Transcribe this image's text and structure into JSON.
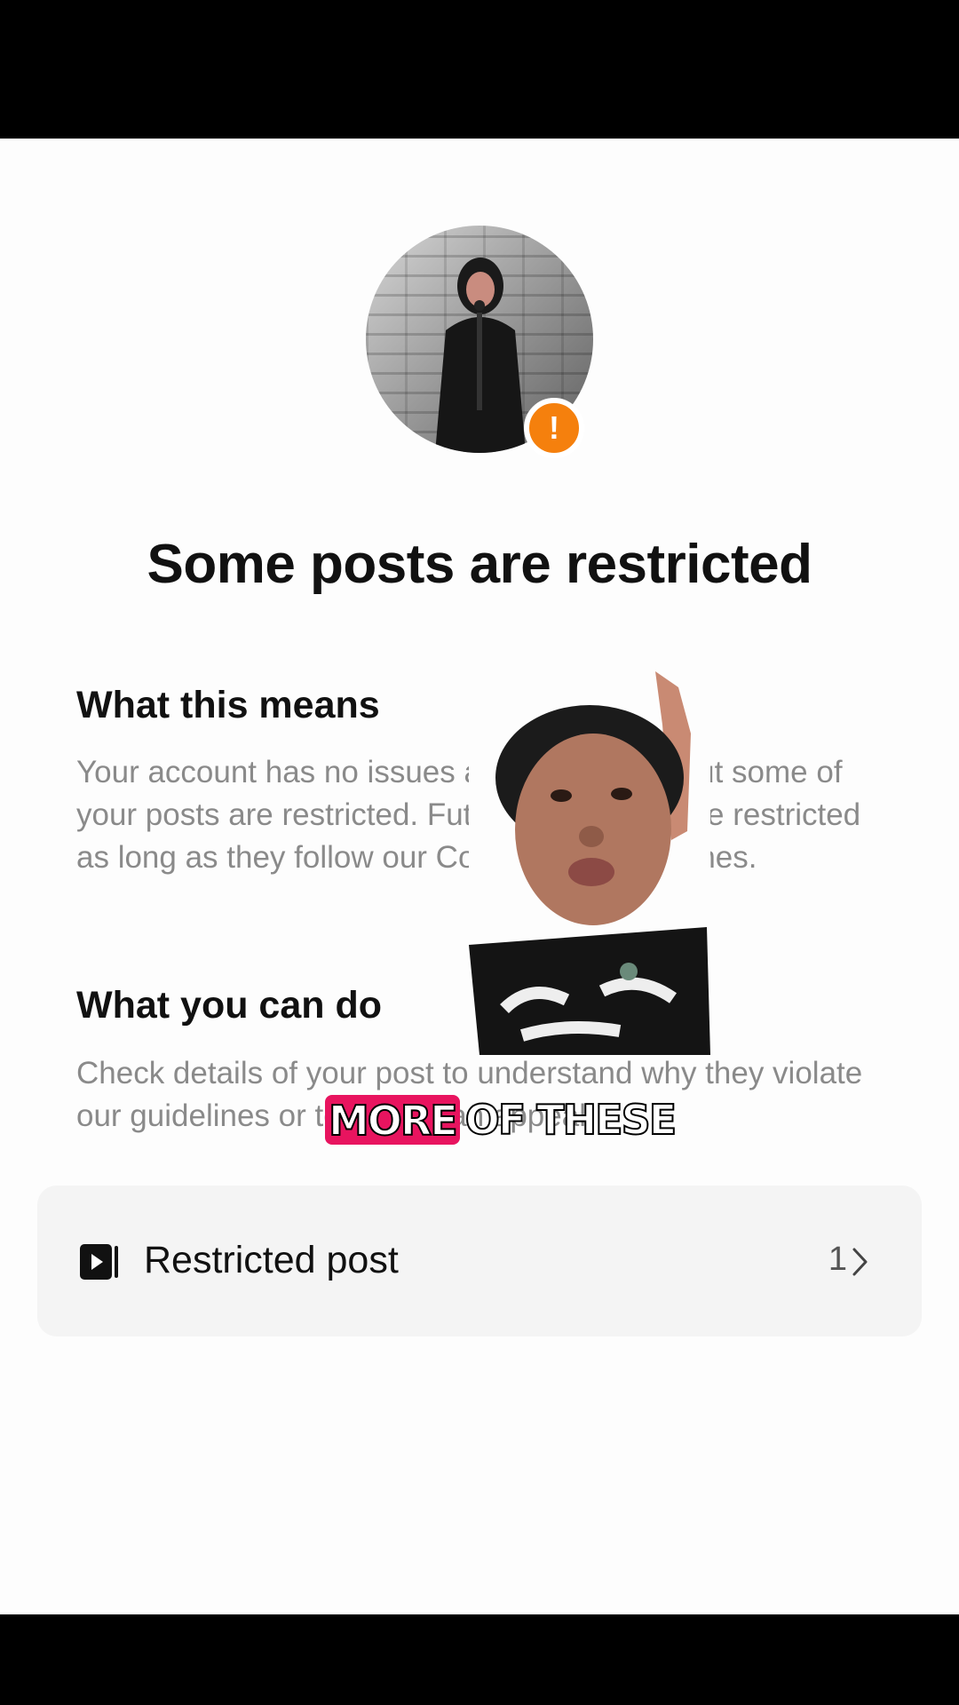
{
  "restriction_page": {
    "title": "Some posts are restricted",
    "alert_icon_glyph": "!",
    "alert_color": "#f5800d",
    "sections": [
      {
        "heading": "What this means",
        "body": "Your account has no issues at the moment, but some of your posts are restricted. Future posts won’t be restricted as long as they follow our Community Guidelines."
      },
      {
        "heading": "What you can do",
        "body": "Check details of your post to understand why they violate our guidelines or to submit an appeal."
      }
    ],
    "restricted_row": {
      "icon": "video-post-icon",
      "label": "Restricted post",
      "count": "1"
    }
  },
  "overlay": {
    "caption_highlight": "MORE",
    "caption_rest": "OF THESE",
    "caption_highlight_color": "#e8145f"
  }
}
